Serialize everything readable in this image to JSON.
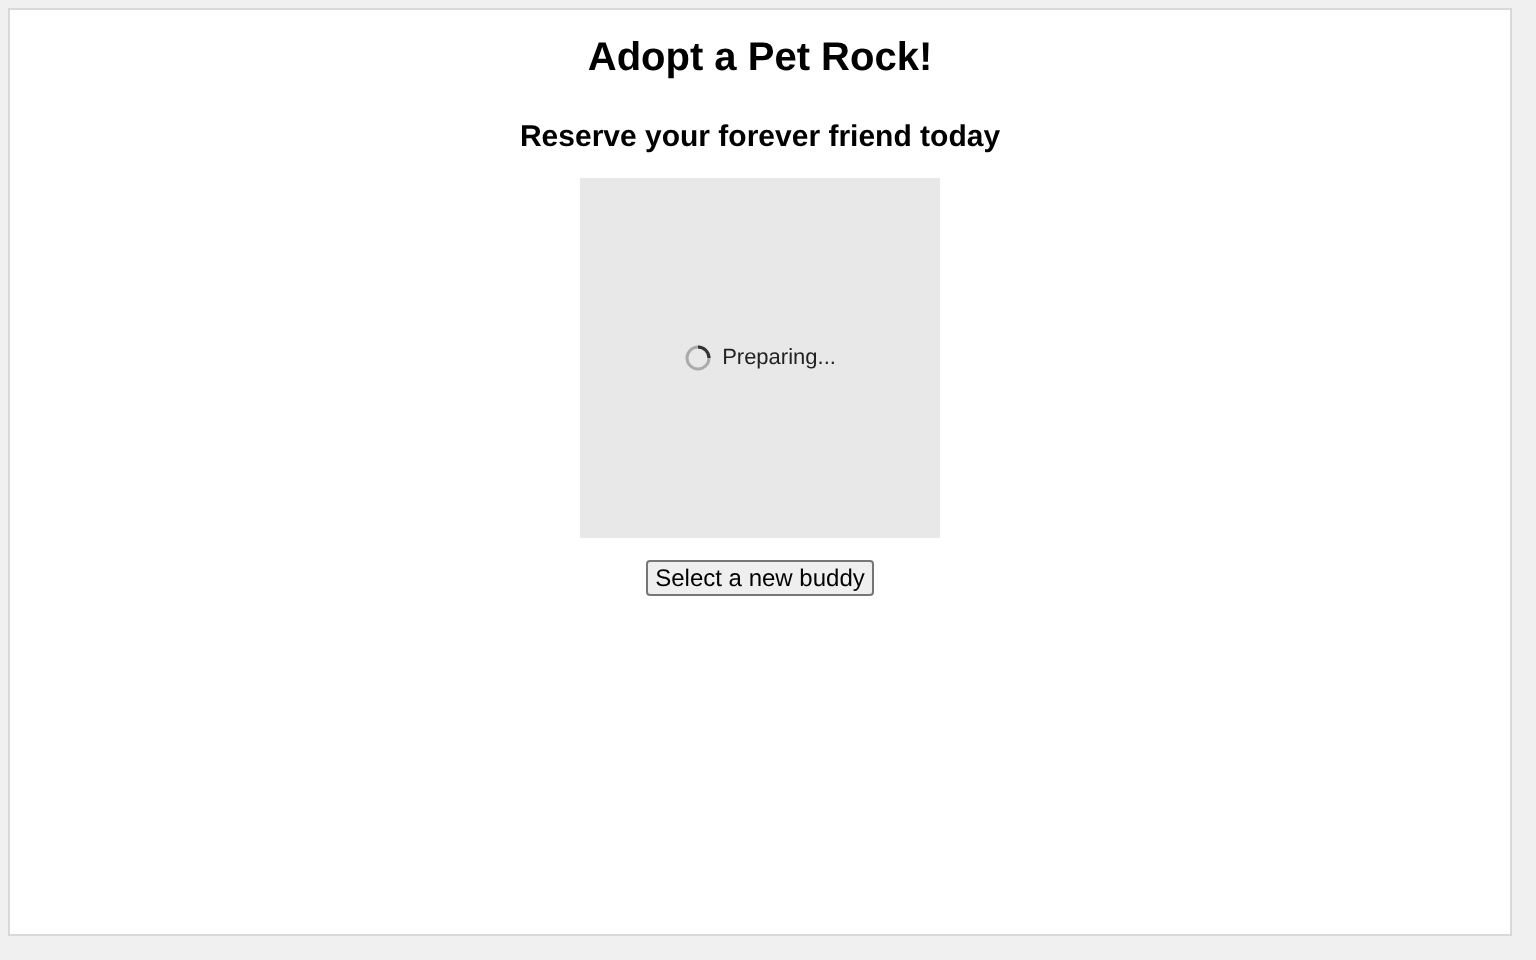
{
  "title": "Adopt a Pet Rock!",
  "subtitle": "Reserve your forever friend today",
  "preview": {
    "loading": true,
    "status": "Preparing..."
  },
  "button": {
    "label": "Select a new buddy"
  }
}
